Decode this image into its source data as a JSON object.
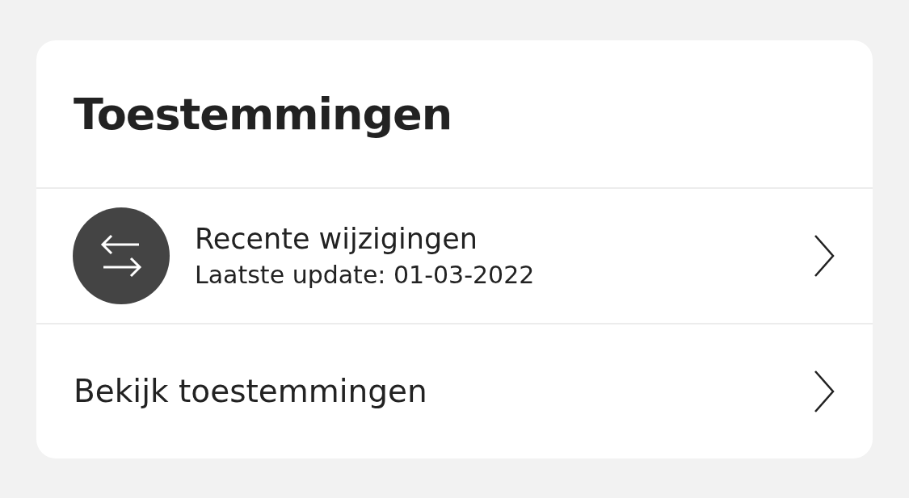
{
  "card": {
    "title": "Toestemmingen",
    "items": [
      {
        "kind": "detail",
        "title": "Recente wijzigingen",
        "subtitle": "Laatste update: 01-03-2022"
      },
      {
        "kind": "plain",
        "title": "Bekijk toestemmingen"
      }
    ]
  }
}
